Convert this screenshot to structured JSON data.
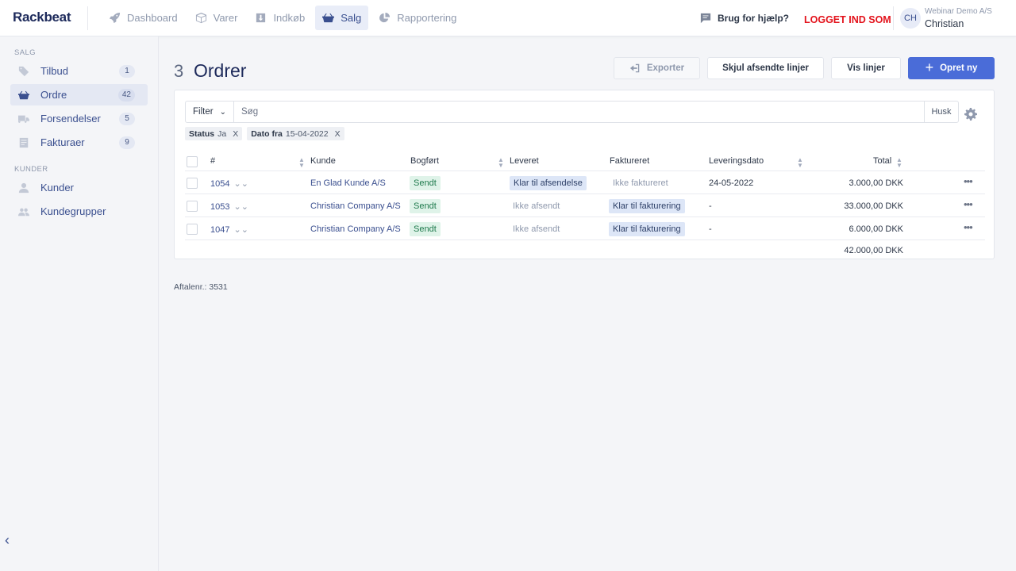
{
  "app": {
    "logo": "Rackbeat"
  },
  "nav": [
    {
      "label": "Dashboard",
      "icon": "rocket-icon"
    },
    {
      "label": "Varer",
      "icon": "box-icon"
    },
    {
      "label": "Indkøb",
      "icon": "inbox-download-icon"
    },
    {
      "label": "Salg",
      "icon": "basket-icon",
      "active": true
    },
    {
      "label": "Rapportering",
      "icon": "pie-chart-icon"
    }
  ],
  "header": {
    "help": "Brug for hjælp?",
    "logged_in_as": "LOGGET IND SOM",
    "avatar": "CH",
    "company": "Webinar Demo A/S",
    "user": "Christian"
  },
  "sidebar": {
    "section_sales": "SALG",
    "section_customers": "KUNDER",
    "items": [
      {
        "label": "Tilbud",
        "count": "1",
        "icon": "tag-icon"
      },
      {
        "label": "Ordre",
        "count": "42",
        "icon": "basket-icon",
        "active": true
      },
      {
        "label": "Forsendelser",
        "count": "5",
        "icon": "truck-icon"
      },
      {
        "label": "Fakturaer",
        "count": "9",
        "icon": "document-icon"
      },
      {
        "label": "Kunder",
        "icon": "person-icon"
      },
      {
        "label": "Kundegrupper",
        "icon": "people-icon"
      }
    ],
    "collapse": "‹"
  },
  "page": {
    "count": "3",
    "title": "Ordrer",
    "export": "Exporter",
    "hide_sent": "Skjul afsendte linjer",
    "show_lines": "Vis linjer",
    "create_new": "Opret ny"
  },
  "filter": {
    "button": "Filter",
    "placeholder": "Søg",
    "remember": "Husk",
    "chips": [
      {
        "key": "Status",
        "value": "Ja"
      },
      {
        "key": "Dato fra",
        "value": "15-04-2022"
      }
    ]
  },
  "table": {
    "columns": [
      "#",
      "Kunde",
      "Bogført",
      "Leveret",
      "Faktureret",
      "Leveringsdato",
      "Total"
    ],
    "rows": [
      {
        "number": "1054",
        "customer": "En Glad Kunde A/S",
        "booked": "Sendt",
        "delivered": "Klar til afsendelse",
        "invoiced": "Ikke faktureret",
        "delivery_date": "24-05-2022",
        "total": "3.000,00 DKK"
      },
      {
        "number": "1053",
        "customer": "Christian Company A/S",
        "booked": "Sendt",
        "delivered": "Ikke afsendt",
        "invoiced": "Klar til fakturering",
        "delivery_date": "-",
        "total": "33.000,00 DKK"
      },
      {
        "number": "1047",
        "customer": "Christian Company A/S",
        "booked": "Sendt",
        "delivered": "Ikke afsendt",
        "invoiced": "Klar til fakturering",
        "delivery_date": "-",
        "total": "6.000,00 DKK"
      }
    ],
    "sum": "42.000,00 DKK"
  },
  "footer": {
    "agreement": "Aftalenr.: 3531"
  },
  "colors": {
    "brand": "#1d2a5b",
    "accent": "#4a6cd8",
    "logged_in": "#e3121b",
    "badge_green": "#dff3e9",
    "badge_blue": "#dde6f7"
  }
}
